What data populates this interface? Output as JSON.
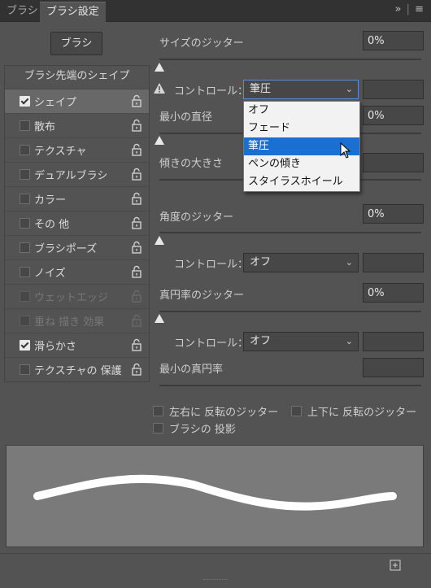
{
  "tabs": [
    {
      "label": "ブラシ",
      "active": false
    },
    {
      "label": "ブラシ設定",
      "active": true
    }
  ],
  "tab_icons": {
    "expand": "»",
    "menu": "≡"
  },
  "brush_button": "ブラシ",
  "sidebar": {
    "heading": "ブラシ先端のシェイプ",
    "items": [
      {
        "label": "シェイプ",
        "checked": true,
        "enabled": true,
        "selected": true
      },
      {
        "label": "散布",
        "checked": false,
        "enabled": true,
        "selected": false
      },
      {
        "label": "テクスチャ",
        "checked": false,
        "enabled": true,
        "selected": false
      },
      {
        "label": "デュアルブラシ",
        "checked": false,
        "enabled": true,
        "selected": false
      },
      {
        "label": "カラー",
        "checked": false,
        "enabled": true,
        "selected": false
      },
      {
        "label": "その 他",
        "checked": false,
        "enabled": true,
        "selected": false
      },
      {
        "label": "ブラシポーズ",
        "checked": false,
        "enabled": true,
        "selected": false
      },
      {
        "label": "ノイズ",
        "checked": false,
        "enabled": true,
        "selected": false
      },
      {
        "label": "ウェットエッジ",
        "checked": false,
        "enabled": false,
        "selected": false
      },
      {
        "label": "重ね 描き 効果",
        "checked": false,
        "enabled": false,
        "selected": false
      },
      {
        "label": "滑らかさ",
        "checked": true,
        "enabled": true,
        "selected": false
      },
      {
        "label": "テクスチャの 保護",
        "checked": false,
        "enabled": true,
        "selected": false
      }
    ]
  },
  "settings": {
    "size_jitter": {
      "label": "サイズのジッター",
      "value": "0%"
    },
    "control1": {
      "label": "コントロール：",
      "value": "筆圧"
    },
    "min_diameter": {
      "label": "最小の直径",
      "value": "0%"
    },
    "tilt_scale": {
      "label": "傾きの大きさ"
    },
    "angle_jitter": {
      "label": "角度のジッター",
      "value": "0%"
    },
    "control2": {
      "label": "コントロール：",
      "value": "オフ"
    },
    "roundness_jitter": {
      "label": "真円率のジッター",
      "value": "0%"
    },
    "control3": {
      "label": "コントロール：",
      "value": "オフ"
    },
    "min_roundness": {
      "label": "最小の真円率"
    }
  },
  "dropdown_menu": {
    "items": [
      "オフ",
      "フェード",
      "筆圧",
      "ペンの傾き",
      "スタイラスホイール"
    ],
    "highlighted_index": 2
  },
  "options": {
    "flip_x": {
      "label": "左右に 反転のジッター",
      "checked": false
    },
    "flip_y": {
      "label": "上下に 反転のジッター",
      "checked": false
    },
    "projection": {
      "label": "ブラシの 投影",
      "checked": false
    }
  },
  "icons": {
    "warning": "warning-icon",
    "lock": "lock-icon",
    "new_preset": "new-preset-icon"
  },
  "colors": {
    "panel_bg": "#535353",
    "selection_blue": "#1b6fd1",
    "menu_bg": "#f2f2f2"
  }
}
